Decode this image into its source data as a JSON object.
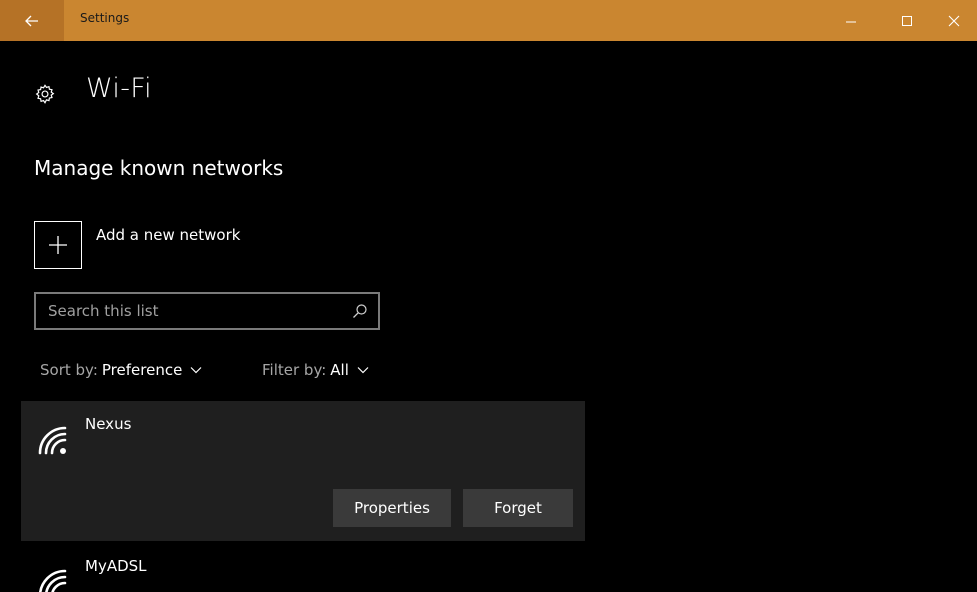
{
  "window": {
    "app_title": "Settings",
    "back_icon": "arrow-left-icon",
    "colors": {
      "accent": "#ca8630",
      "back_bg": "#b57226",
      "background": "#000000"
    }
  },
  "header": {
    "title": "Wi-Fi",
    "icon": "gear-icon"
  },
  "section": {
    "title": "Manage known networks"
  },
  "add_network": {
    "label": "Add a new network",
    "icon": "plus-icon"
  },
  "search": {
    "placeholder": "Search this list",
    "value": ""
  },
  "sort": {
    "prefix": "Sort by:",
    "value": "Preference"
  },
  "filter": {
    "prefix": "Filter by:",
    "value": "All"
  },
  "networks": [
    {
      "name": "Nexus",
      "selected": true,
      "icon": "wifi-icon"
    },
    {
      "name": "MyADSL",
      "selected": false,
      "icon": "wifi-icon"
    }
  ],
  "actions": {
    "properties": "Properties",
    "forget": "Forget"
  }
}
